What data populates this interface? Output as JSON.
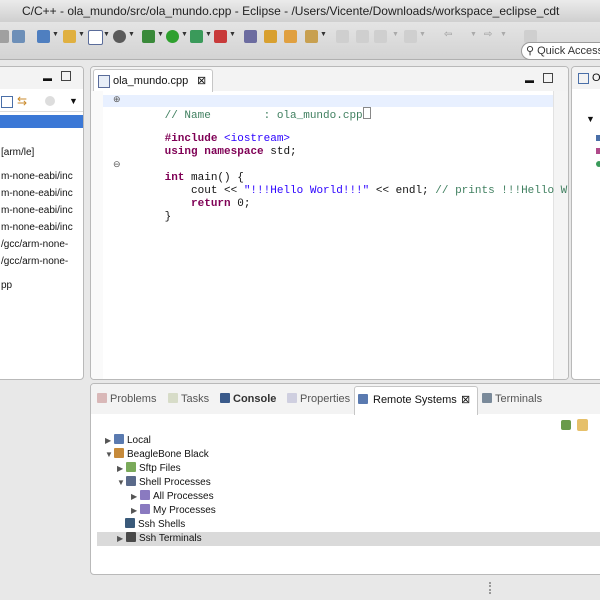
{
  "window": {
    "title": "C/C++ - ola_mundo/src/ola_mundo.cpp - Eclipse - /Users/Vicente/Downloads/workspace_eclipse_cdt"
  },
  "toolbar": {
    "quick_access": "Quick Access"
  },
  "project_explorer": {
    "rows": [
      "[arm/le]",
      "m-none-eabi/inc",
      "m-none-eabi/inc",
      "m-none-eabi/inc",
      "m-none-eabi/inc",
      "/gcc/arm-none-",
      "/gcc/arm-none-",
      "pp"
    ]
  },
  "editor": {
    "tab_label": "ola_mundo.cpp",
    "lines": {
      "l1_comment": "// Name        : ola_mundo.cpp",
      "l2_kw": "#include",
      "l2_rest": " <iostream>",
      "l3_kw1": "using",
      "l3_kw2": "namespace",
      "l3_rest": " std;",
      "l4_kw": "int",
      "l4_rest": " main() {",
      "l5_pre": "    cout << ",
      "l5_str": "\"!!!Hello World!!!\"",
      "l5_mid": " << endl; ",
      "l5_comment": "// prints !!!Hello World!!!",
      "l6_kw": "return",
      "l6_rest": " 0;",
      "l7": "}"
    }
  },
  "outline": {
    "tab_label": "O"
  },
  "bottom_tabs": {
    "problems": "Problems",
    "tasks": "Tasks",
    "console": "Console",
    "properties": "Properties",
    "remote_systems": "Remote Systems",
    "terminals": "Terminals"
  },
  "remote_tree": {
    "local": "Local",
    "beaglebone": "BeagleBone Black",
    "sftp": "Sftp Files",
    "shell_processes": "Shell Processes",
    "all_processes": "All Processes",
    "my_processes": "My Processes",
    "ssh_shells": "Ssh Shells",
    "ssh_terminals": "Ssh Terminals"
  },
  "colors": {
    "selection": "#3b78d6",
    "keyword": "#7f0055",
    "string": "#2a00ff",
    "comment": "#3f7f5f"
  }
}
